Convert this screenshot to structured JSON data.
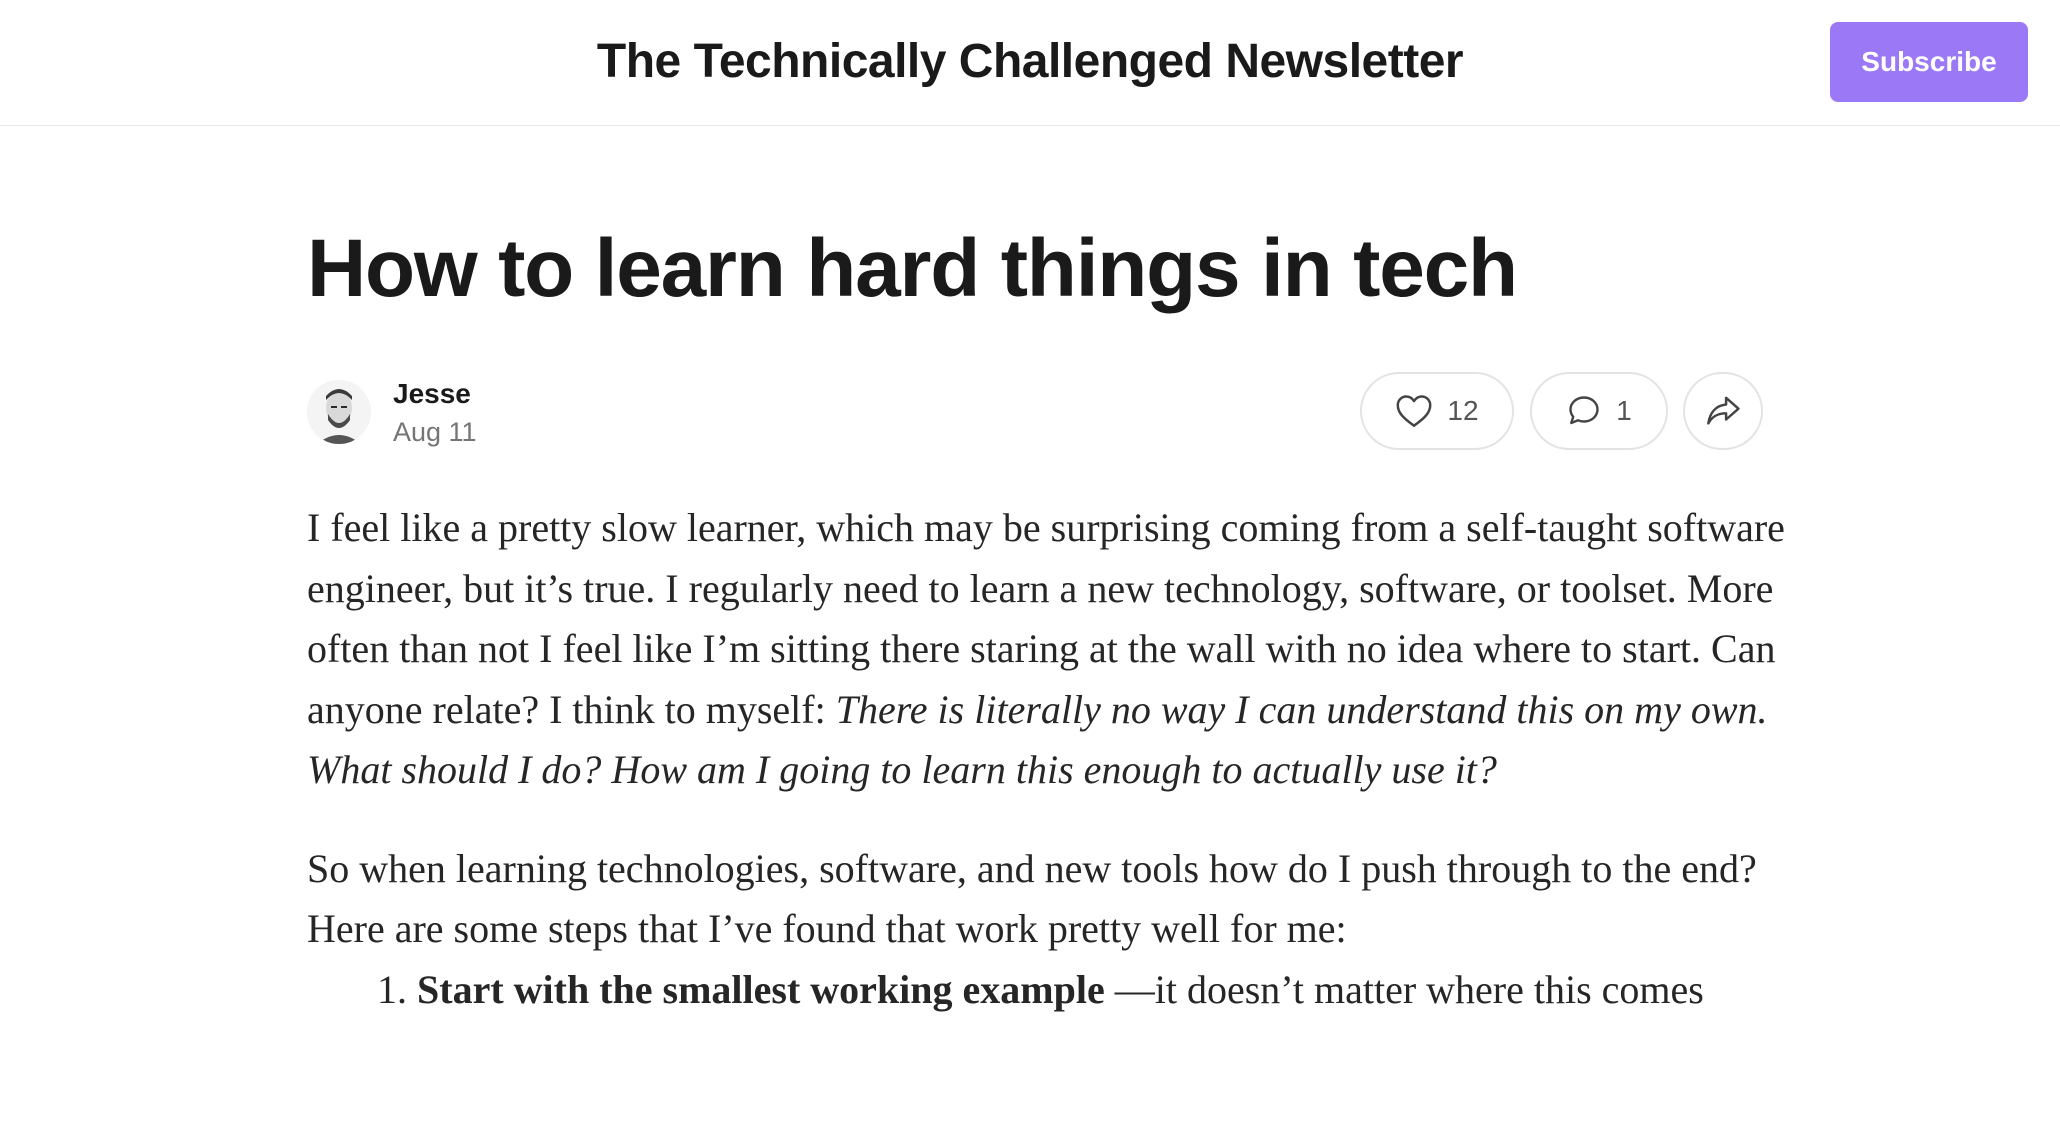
{
  "header": {
    "publication_title": "The Technically Challenged Newsletter",
    "subscribe_label": "Subscribe",
    "subscribe_color": "#9b78f5"
  },
  "post": {
    "title": "How to learn hard things in tech",
    "author": "Jesse",
    "date": "Aug 11",
    "like_count": "12",
    "comment_count": "1",
    "icons": [
      "heart-icon",
      "comment-icon",
      "share-icon"
    ],
    "paragraph1_plain": "I feel like a pretty slow learner, which may be surprising coming from a self-taught software engineer, but it’s true. I regularly need to learn a new technology, software, or toolset. More often than not I feel like I’m sitting there staring at the wall with no idea where to start. Can anyone relate? I think to myself: ",
    "paragraph1_italic": "There is literally no way I can understand this on my own. What should I do? How am I going to learn this enough to actually use it?",
    "paragraph2": "So when learning technologies, software, and new tools how do I push through to the end? Here are some steps that I’ve found that work pretty well for me:",
    "list": [
      {
        "number": "1.",
        "bold": "Start with the smallest working example",
        "text": " —it doesn’t matter where this comes"
      }
    ]
  }
}
